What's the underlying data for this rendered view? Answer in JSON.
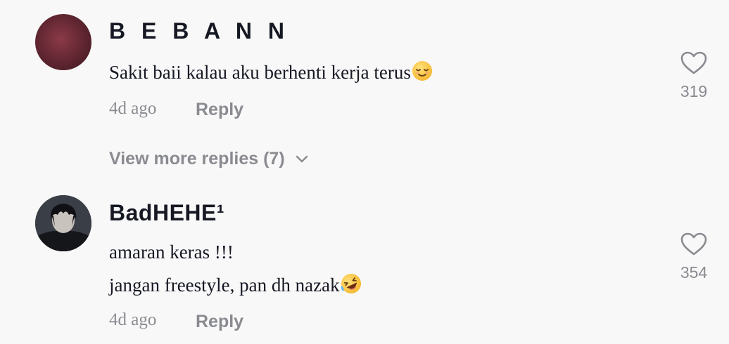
{
  "comments": [
    {
      "username": "B E B A N N",
      "lines": [
        "Sakit baii kalau aku berhenti kerja terus"
      ],
      "emoji": "relieved-face",
      "time": "4d ago",
      "reply_label": "Reply",
      "likes": "319"
    },
    {
      "username": "BadHEHE¹",
      "lines": [
        "amaran keras !!!",
        "jangan freestyle, pan dh nazak"
      ],
      "emoji": "rolling-on-floor-laughing-face",
      "time": "4d ago",
      "reply_label": "Reply",
      "likes": "354"
    }
  ],
  "view_more": "View more replies (7)",
  "icons": [
    "heart-icon",
    "chevron-down-icon"
  ],
  "colors": {
    "background": "#f8f8f8",
    "primary_text": "#161823",
    "secondary_text": "#8a8b91",
    "emoji_yellow": "#f7c430"
  }
}
